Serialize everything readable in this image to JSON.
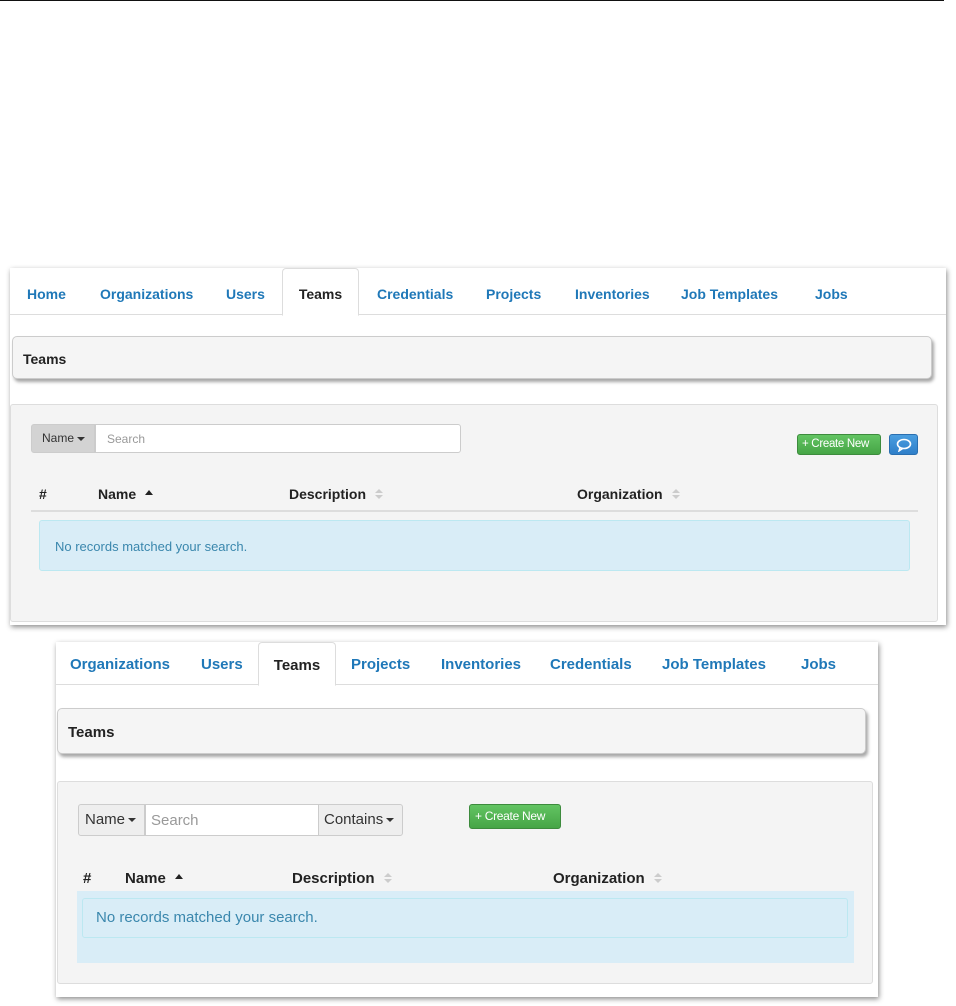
{
  "shot1": {
    "tabs": [
      {
        "label": "Home"
      },
      {
        "label": "Organizations"
      },
      {
        "label": "Users"
      },
      {
        "label": "Teams",
        "active": true
      },
      {
        "label": "Credentials"
      },
      {
        "label": "Projects"
      },
      {
        "label": "Inventories"
      },
      {
        "label": "Job Templates"
      },
      {
        "label": "Jobs"
      }
    ],
    "title": "Teams",
    "search": {
      "field_label": "Name",
      "placeholder": "Search"
    },
    "create_button_label": "+ Create New",
    "chat_icon": "comments-icon",
    "columns": [
      "#",
      "Name",
      "Description",
      "Organization"
    ],
    "sort": {
      "column": "Name",
      "direction": "ascending"
    },
    "empty_message": "No records matched your search."
  },
  "shot2": {
    "tabs": [
      {
        "label": "Organizations"
      },
      {
        "label": "Users"
      },
      {
        "label": "Teams",
        "active": true
      },
      {
        "label": "Projects"
      },
      {
        "label": "Inventories"
      },
      {
        "label": "Credentials"
      },
      {
        "label": "Job Templates"
      },
      {
        "label": "Jobs"
      }
    ],
    "title": "Teams",
    "search": {
      "field_label": "Name",
      "placeholder": "Search",
      "operator_label": "Contains"
    },
    "create_button_label": "+ Create New",
    "columns": [
      "#",
      "Name",
      "Description",
      "Organization"
    ],
    "sort": {
      "column": "Name",
      "direction": "ascending"
    },
    "empty_message": "No records matched your search."
  },
  "colors": {
    "tab_link": "#1f78b8",
    "create_button": "#46a546",
    "chat_button": "#2f7fc9",
    "alert_bg": "#d9edf7",
    "alert_text": "#3a87ad"
  }
}
